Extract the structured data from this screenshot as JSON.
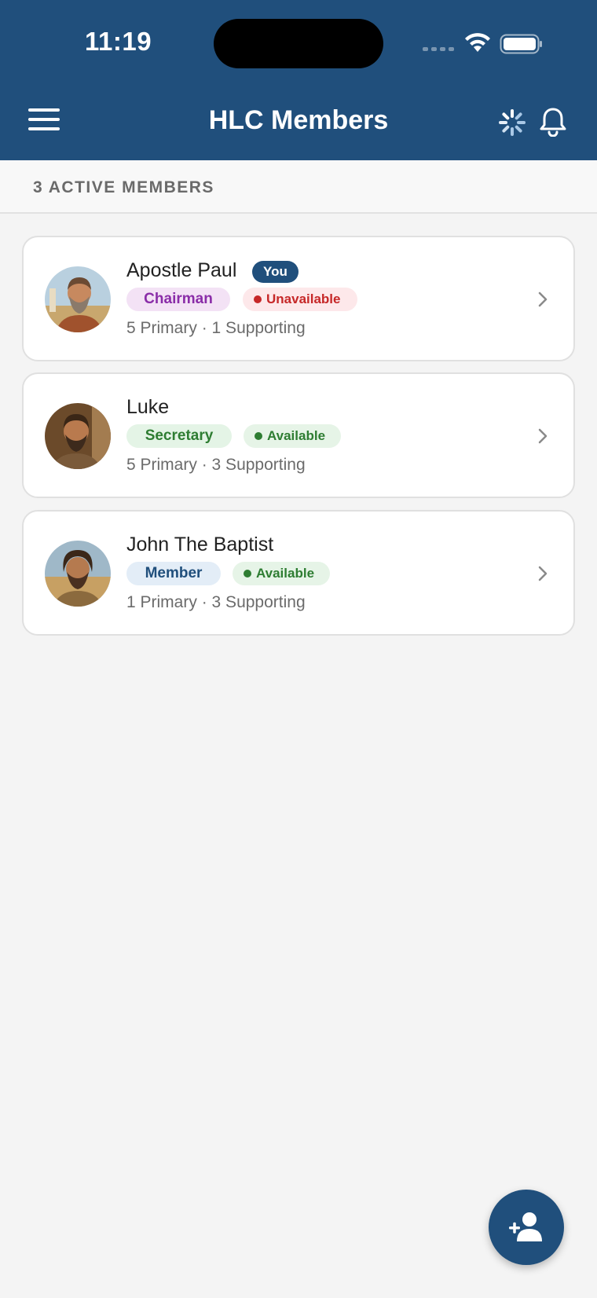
{
  "status_bar": {
    "time": "11:19"
  },
  "header": {
    "title": "HLC Members",
    "icons": [
      "menu-icon",
      "loading-spinner-icon",
      "bell-icon"
    ],
    "background_color": "#204f7c"
  },
  "section": {
    "label": "3 ACTIVE MEMBERS"
  },
  "members": [
    {
      "name": "Apostle Paul",
      "you_badge": "You",
      "role": "Chairman",
      "role_bg": "#f3e2f5",
      "role_color": "#8a2da8",
      "status": "Unavailable",
      "status_bg": "#fde8ea",
      "status_color": "#c62828",
      "primary": "5 Primary",
      "separator": "·",
      "supporting": "1 Supporting"
    },
    {
      "name": "Luke",
      "role": "Secretary",
      "role_bg": "#e4f4e6",
      "role_color": "#2e7d32",
      "status": "Available",
      "status_bg": "#e6f4e7",
      "status_color": "#2e7d32",
      "primary": "5 Primary",
      "separator": "·",
      "supporting": "3 Supporting"
    },
    {
      "name": "John The Baptist",
      "role": "Member",
      "role_bg": "#e3edf7",
      "role_color": "#204f7c",
      "status": "Available",
      "status_bg": "#e6f4e7",
      "status_color": "#2e7d32",
      "primary": "1 Primary",
      "separator": "·",
      "supporting": "3 Supporting"
    }
  ],
  "fab": {
    "icon": "add-person-icon"
  }
}
